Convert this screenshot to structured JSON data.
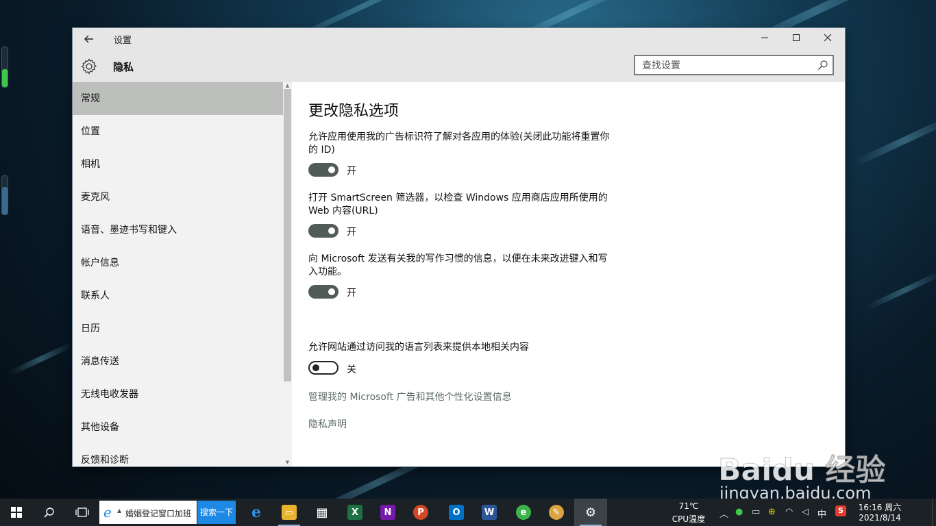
{
  "window": {
    "app_title": "设置",
    "page_title": "隐私",
    "search_placeholder": "查找设置"
  },
  "sidebar": {
    "items": [
      {
        "label": "常规",
        "active": true
      },
      {
        "label": "位置"
      },
      {
        "label": "相机"
      },
      {
        "label": "麦克风"
      },
      {
        "label": "语音、墨迹书写和键入"
      },
      {
        "label": "帐户信息"
      },
      {
        "label": "联系人"
      },
      {
        "label": "日历"
      },
      {
        "label": "消息传送"
      },
      {
        "label": "无线电收发器"
      },
      {
        "label": "其他设备"
      },
      {
        "label": "反馈和诊断"
      }
    ]
  },
  "content": {
    "heading": "更改隐私选项",
    "settings": [
      {
        "desc": "允许应用使用我的广告标识符了解对各应用的体验(关闭此功能将重置你的 ID)",
        "state": "开",
        "on": true
      },
      {
        "desc": "打开 SmartScreen 筛选器，以检查 Windows 应用商店应用所使用的 Web 内容(URL)",
        "state": "开",
        "on": true
      },
      {
        "desc": "向 Microsoft 发送有关我的写作习惯的信息，以便在未来改进键入和写入功能。",
        "state": "开",
        "on": true
      },
      {
        "desc": "允许网站通过访问我的语言列表来提供本地相关内容",
        "state": "关",
        "on": false
      }
    ],
    "links": [
      "管理我的 Microsoft 广告和其他个性化设置信息",
      "隐私声明"
    ]
  },
  "watermark": {
    "main": "Baidu 经验",
    "sub": "jingyan.baidu.com"
  },
  "taskbar": {
    "search_text": "婚姻登记窗口加班",
    "search_button": "搜索一下",
    "apps": [
      {
        "name": "edge",
        "label": "e",
        "color": "#1e7fd6"
      },
      {
        "name": "file-explorer",
        "label": "▭",
        "color": "#e8b32c"
      },
      {
        "name": "store",
        "label": "▦",
        "color": "#ffffff"
      },
      {
        "name": "excel",
        "label": "X",
        "color": "#1e7145"
      },
      {
        "name": "onenote",
        "label": "N",
        "color": "#7719aa"
      },
      {
        "name": "powerpoint",
        "label": "P",
        "color": "#d24726"
      },
      {
        "name": "outlook",
        "label": "O",
        "color": "#0072c6"
      },
      {
        "name": "word",
        "label": "W",
        "color": "#2b579a"
      },
      {
        "name": "browser-360",
        "label": "e",
        "color": "#3bb54a"
      },
      {
        "name": "paint",
        "label": "✎",
        "color": "#d9a441"
      },
      {
        "name": "settings",
        "label": "⚙",
        "color": "#555555"
      }
    ],
    "cpu_temp": "71℃",
    "cpu_label": "CPU温度",
    "ime": "中",
    "time": "16:16 周六",
    "date": "2021/8/14"
  }
}
